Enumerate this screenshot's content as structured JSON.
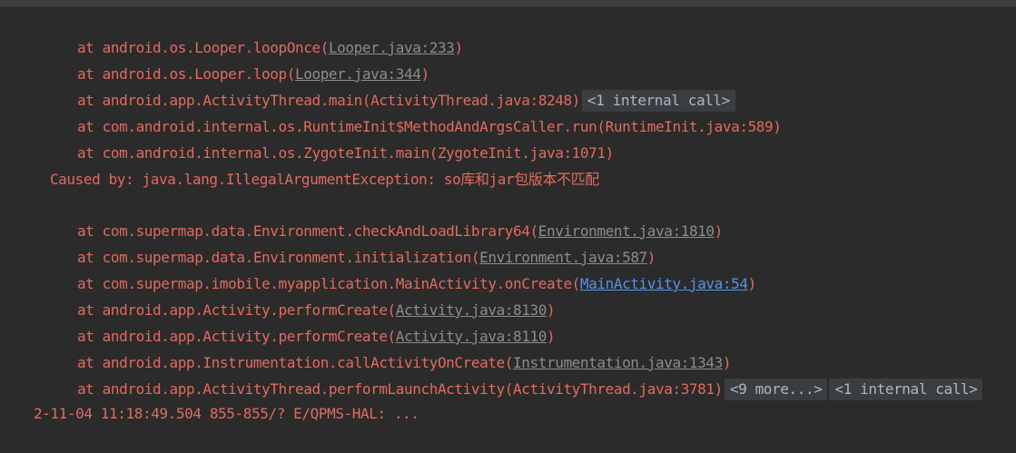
{
  "lines": [
    {
      "prefix": "at android.os.Looper.loopOnce(",
      "file": "Looper.java:233",
      "suffix": ")"
    },
    {
      "prefix": "at android.os.Looper.loop(",
      "file": "Looper.java:344",
      "suffix": ")"
    },
    {
      "prefix": "at android.app.ActivityThread.main(ActivityThread.java:8248)",
      "fold": "<1 internal call>"
    },
    {
      "prefix": "at com.android.internal.os.RuntimeInit$MethodAndArgsCaller.run(RuntimeInit.java:589)"
    },
    {
      "prefix": "at com.android.internal.os.ZygoteInit.main(ZygoteInit.java:1071)"
    },
    {
      "caused": "Caused by: java.lang.IllegalArgumentException: so库和jar包版本不匹配"
    },
    {
      "prefix": "at com.supermap.data.Environment.checkAndLoadLibrary64(",
      "file": "Environment.java:1810",
      "suffix": ")"
    },
    {
      "prefix": "at com.supermap.data.Environment.initialization(",
      "file": "Environment.java:587",
      "suffix": ")"
    },
    {
      "prefix": "at com.supermap.imobile.myapplication.MainActivity.onCreate(",
      "file": "MainActivity.java:54",
      "suffix": ")"
    },
    {
      "prefix": "at android.app.Activity.performCreate(",
      "file": "Activity.java:8130",
      "suffix": ")"
    },
    {
      "prefix": "at android.app.Activity.performCreate(",
      "file": "Activity.java:8110",
      "suffix": ")"
    },
    {
      "prefix": "at android.app.Instrumentation.callActivityOnCreate(",
      "file": "Instrumentation.java:1343",
      "suffix": ")"
    },
    {
      "prefix": "at android.app.ActivityThread.performLaunchActivity(ActivityThread.java:3781)",
      "fold": "<9 more...>",
      "fold2": "<1 internal call>"
    }
  ],
  "partial_line": "2-11-04 11:18:49.504 855-855/? E/QPMS-HAL: ..."
}
